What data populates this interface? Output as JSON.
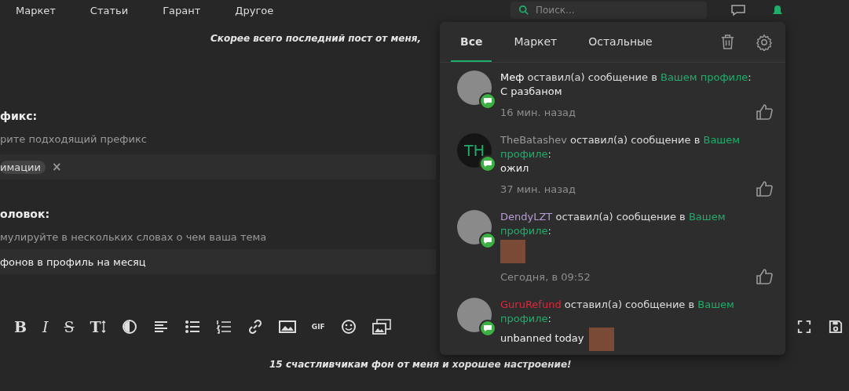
{
  "nav": {
    "items": [
      {
        "label": "Маркет"
      },
      {
        "label": "Статьи"
      },
      {
        "label": "Гарант"
      },
      {
        "label": "Другое"
      }
    ],
    "search": {
      "placeholder": "Поиск..."
    }
  },
  "post": {
    "intro": "Скорее всего последний пост от меня,",
    "prefix": {
      "label": "фикс:",
      "hint": "рите подходящий префикс",
      "tag": "имации",
      "remove": "×"
    },
    "title": {
      "label": "оловок:",
      "hint": "мулируйте в нескольких словах о чем ваша тема",
      "value": "фонов в профиль на месяц"
    },
    "toolbar": [
      {
        "kind": "bold",
        "label": "B"
      },
      {
        "kind": "italic",
        "label": "I"
      },
      {
        "kind": "strike",
        "label": "S"
      },
      {
        "kind": "size",
        "label": "T"
      },
      {
        "kind": "contrast"
      },
      {
        "kind": "align"
      },
      {
        "kind": "bullets"
      },
      {
        "kind": "numbers"
      },
      {
        "kind": "link"
      },
      {
        "kind": "image"
      },
      {
        "kind": "gif",
        "label": "GIF"
      },
      {
        "kind": "smile"
      },
      {
        "kind": "gallery"
      }
    ],
    "toolbar_right": [
      {
        "kind": "fullscreen"
      },
      {
        "kind": "save"
      }
    ],
    "outro": "15 счастливчикам фон от меня и хорошее настроение!"
  },
  "notifications": {
    "tabs": [
      {
        "label": "Все",
        "selected": true
      },
      {
        "label": "Маркет",
        "selected": false
      },
      {
        "label": "Остальные",
        "selected": false
      }
    ],
    "items": [
      {
        "author": "Меф",
        "color": "#ffffff",
        "action": "оставил(а) сообщение в",
        "link": "Вашем профиле",
        "colon": ":",
        "message": "С разбаном",
        "attachment": false,
        "time": "16 мин. назад"
      },
      {
        "initials": "TH",
        "author": "TheBatashev",
        "color": "#9a9a9a",
        "action": "оставил(а) сообщение в",
        "link": "Вашем профиле",
        "colon": ":",
        "message": "ожил",
        "attachment": false,
        "time": "37 мин. назад"
      },
      {
        "author": "DendyLZT",
        "color": "#b89ad8",
        "action": "оставил(а) сообщение в",
        "link": "Вашем профиле",
        "colon": ":",
        "attachment": true,
        "time": "Сегодня, в 09:52"
      },
      {
        "author": "GuruRefund",
        "color": "#e0263a",
        "action": "оставил(а) сообщение в",
        "link": "Вашем профиле",
        "colon": ":",
        "message": "unbanned today",
        "attachment": true
      }
    ]
  }
}
